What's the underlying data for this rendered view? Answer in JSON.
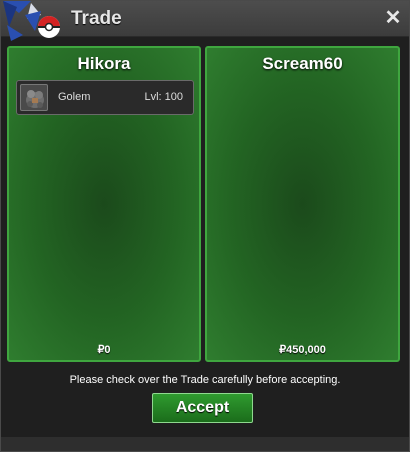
{
  "window": {
    "title": "Trade",
    "close_glyph": "✕"
  },
  "left_panel": {
    "player": "Hikora",
    "money": "₽0",
    "items": [
      {
        "icon": "golem-sprite-icon",
        "name": "Golem",
        "level": "Lvl: 100"
      }
    ]
  },
  "right_panel": {
    "player": "Scream60",
    "money": "₽450,000",
    "items": []
  },
  "notice": "Please check over the Trade carefully before accepting.",
  "accept_label": "Accept",
  "colors": {
    "panel_green": "#236523",
    "panel_border": "#3fa63f",
    "button_green": "#2f9a2f",
    "titlebar": "#454545"
  }
}
